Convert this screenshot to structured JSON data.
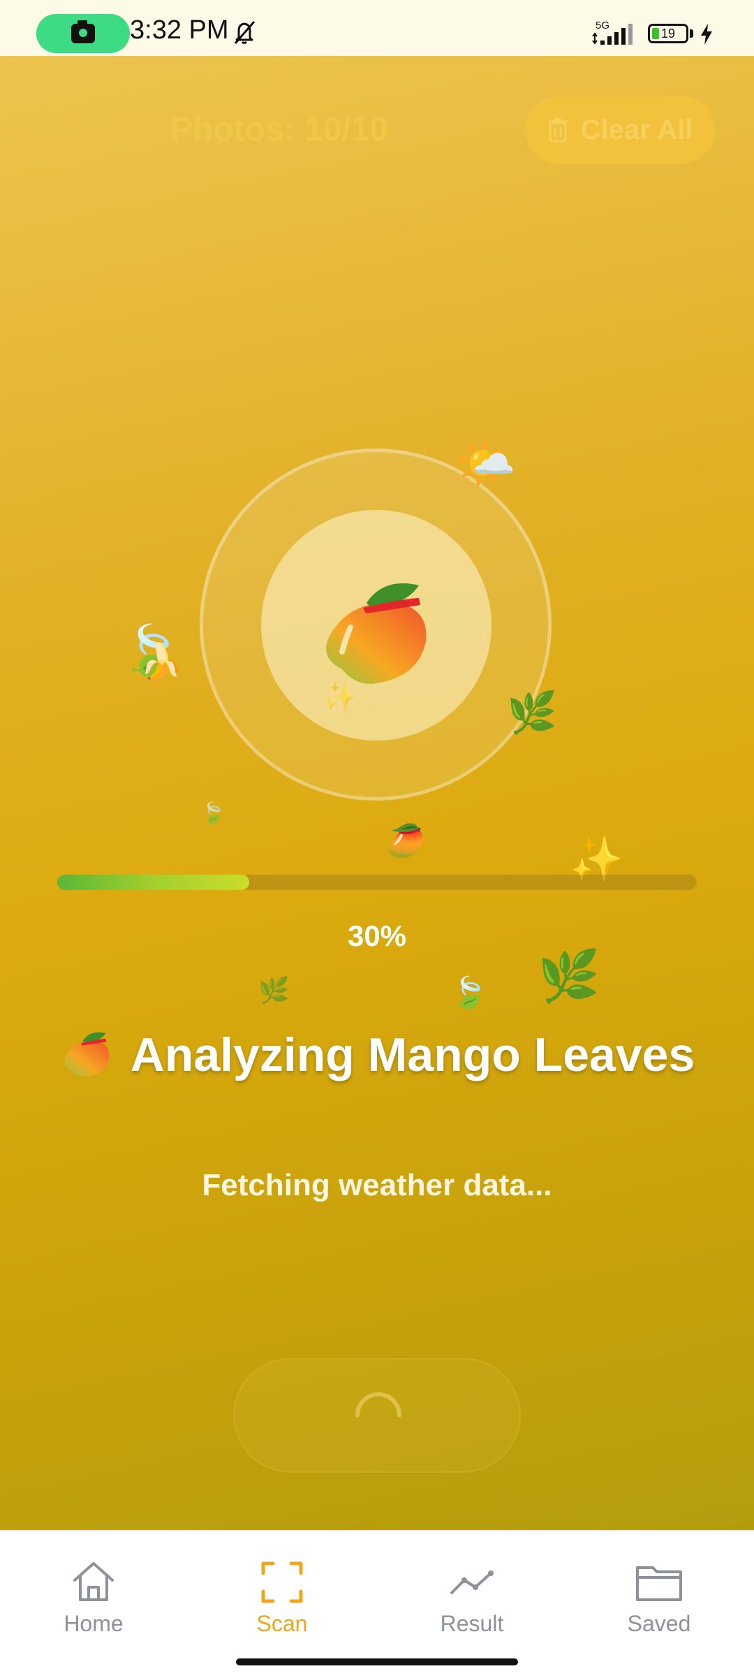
{
  "status_bar": {
    "time": "3:32 PM",
    "network": "5G",
    "battery": "19",
    "icons": [
      "camera-icon",
      "bell-off-icon",
      "signal-icon",
      "battery-icon",
      "charging-bolt-icon"
    ]
  },
  "header": {
    "photos_count": "Photos: 10/10",
    "clear_all_label": "Clear All"
  },
  "analysis": {
    "progress_percent": 30,
    "progress_label": "30%",
    "title_emoji": "🥭",
    "title": "Analyzing Mango Leaves",
    "status_text": "Fetching weather data..."
  },
  "decorations": {
    "sun_cloud": "🌤️",
    "banana": "🍌",
    "leaf": "🍃",
    "herb": "🌿",
    "sparkles": "✨",
    "small_mango": "🥭",
    "sparkle": "✨"
  },
  "bottom_nav": {
    "items": [
      {
        "label": "Home",
        "icon": "home-icon"
      },
      {
        "label": "Scan",
        "icon": "scan-icon",
        "active": true
      },
      {
        "label": "Result",
        "icon": "chart-line-icon"
      },
      {
        "label": "Saved",
        "icon": "folder-icon"
      }
    ]
  },
  "colors": {
    "accent": "#efa61b",
    "background_top": "#ecc44e",
    "background_bottom": "#b49d0d",
    "progress": "#7cc232"
  }
}
